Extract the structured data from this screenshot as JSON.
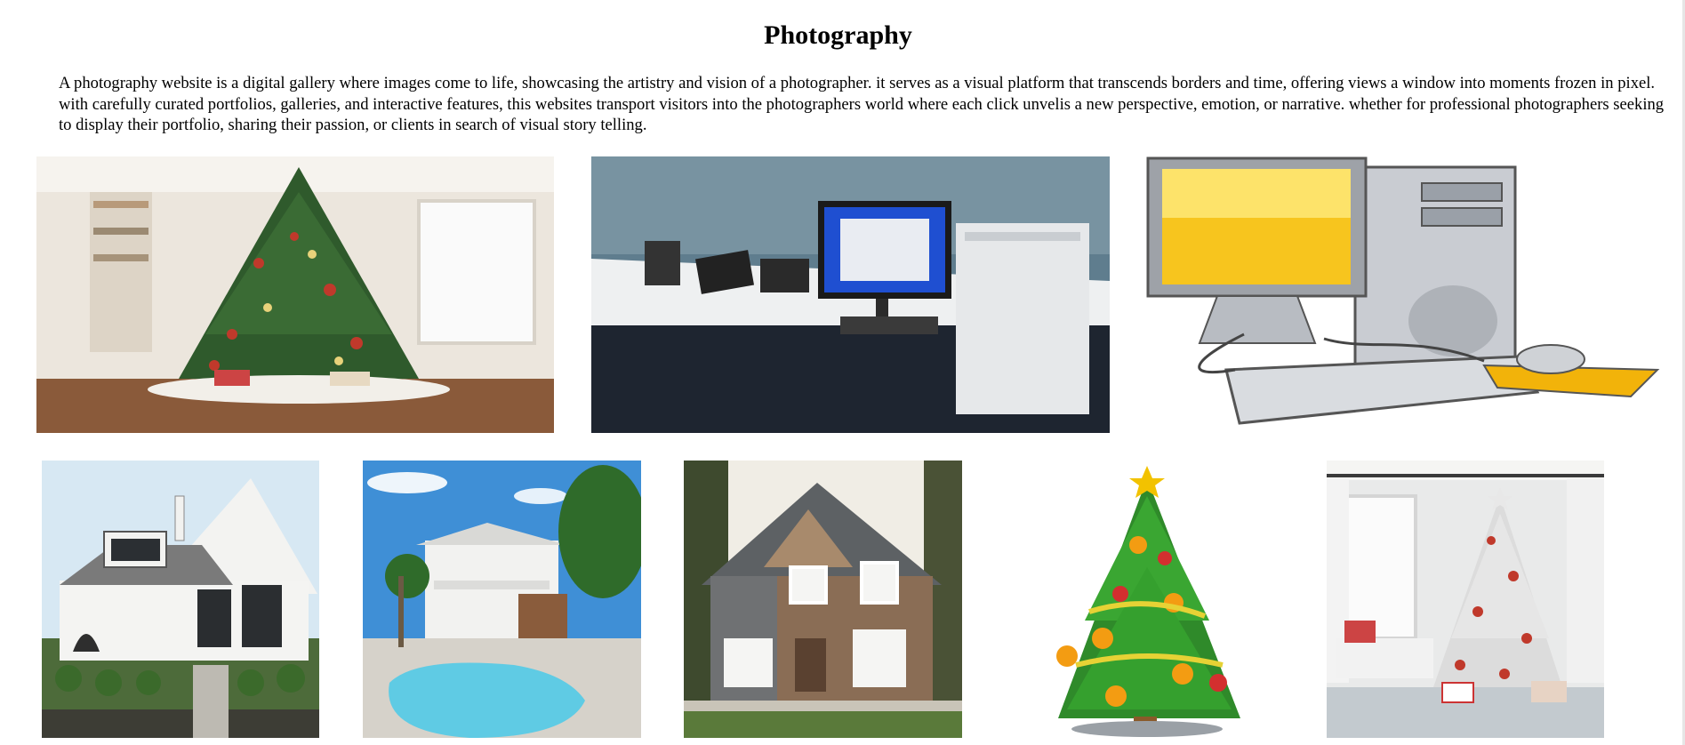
{
  "page": {
    "title": "Photography",
    "intro": "A photography website is a digital gallery where images come to life, showcasing the artistry and vision of a photographer. it serves as a visual platform that transcends borders and time, offering views a window into moments frozen in pixel. with carefully curated portfolios, galleries, and interactive features, this websites transport visitors into the photographers world where each click unvelis a new perspective, emotion, or narrative. whether for professional photographers seeking to display their portfolio, sharing their passion, or clients in search of visual story telling."
  },
  "gallery": {
    "photos": [
      {
        "subject": "christmas-tree-living-room"
      },
      {
        "subject": "computer-desk-setup"
      },
      {
        "subject": "desktop-computer-clipart"
      },
      {
        "subject": "white-cottage-house"
      },
      {
        "subject": "house-with-pool"
      },
      {
        "subject": "craftsman-house"
      },
      {
        "subject": "christmas-tree-clipart"
      },
      {
        "subject": "christmas-tree-white-room"
      }
    ]
  }
}
